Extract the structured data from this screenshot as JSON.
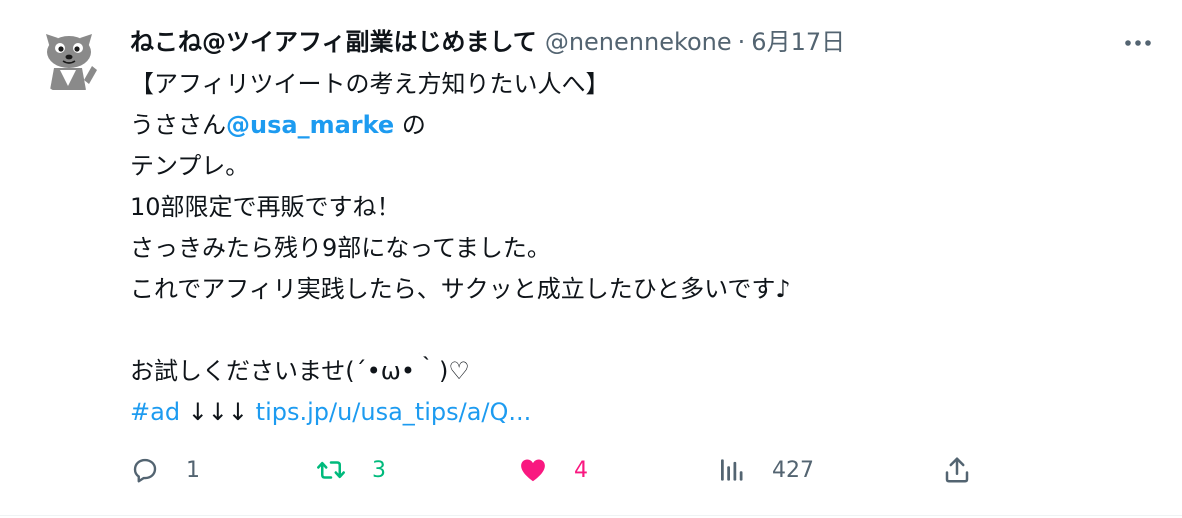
{
  "tweet": {
    "display_name": "ねこね@ツイアフィ副業はじめまして",
    "handle": "@nenennekone",
    "separator": "·",
    "date": "6月17日",
    "body": {
      "line1": "【アフィリツイートの考え方知りたい人へ】",
      "line2_prefix": "うささん",
      "line2_mention": "@usa_marke",
      "line2_suffix": " の",
      "line3": "テンプレ。",
      "line4": "10部限定で再販ですね！",
      "line5": "さっきみたら残り9部になってました。",
      "line6": "これでアフィリ実践したら、サクッと成立したひと多いです♪",
      "line8": "お試しくださいませ(´•ω•｀)♡",
      "line9_hashtag": "#ad",
      "line9_arrows": " ↓↓↓ ",
      "line9_link": "tips.jp/u/usa_tips/a/Q..."
    },
    "actions": {
      "reply_count": "1",
      "retweet_count": "3",
      "like_count": "4",
      "views_count": "427"
    },
    "colors": {
      "link": "#1d9bf0",
      "retweet": "#00ba7c",
      "like": "#f91880",
      "secondary_text": "#536471"
    },
    "icons": {
      "avatar": "cat-avatar-icon",
      "more": "more-dots-icon",
      "reply": "reply-icon",
      "retweet": "retweet-icon",
      "like": "heart-filled-icon",
      "views": "views-bar-chart-icon",
      "share": "share-icon"
    }
  }
}
